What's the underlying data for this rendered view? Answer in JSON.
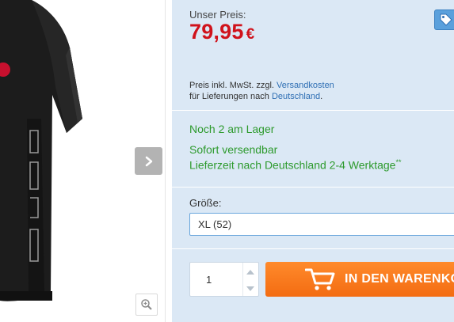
{
  "gallery": {
    "next_icon": "chevron-right-icon",
    "zoom_icon": "zoom-in-icon"
  },
  "pricing": {
    "label": "Unser Preis:",
    "value": "79,95",
    "currency": "€",
    "vat_prefix": "Preis inkl. MwSt. zzgl.",
    "shipping_link": "Versandkosten",
    "delivery_prefix": "für Lieferungen nach",
    "country_link": "Deutschland",
    "country_suffix": ".",
    "tag_icon": "price-tag-icon"
  },
  "availability": {
    "stock": "Noch 2 am Lager",
    "shipping": "Sofort versendbar",
    "delivery_time": "Lieferzeit nach Deutschland 2-4 Werktage",
    "footnote": "**"
  },
  "options": {
    "size_label": "Größe:",
    "size_selected": "XL (52)"
  },
  "purchase": {
    "quantity": "1",
    "cart_label": "IN DEN WARENKORB"
  },
  "colors": {
    "price": "#d0121b",
    "stock_green": "#2d9a2d",
    "panel_bg": "#dbe8f5",
    "cart_orange": "#f36c12",
    "link_blue": "#2f6fb4"
  }
}
